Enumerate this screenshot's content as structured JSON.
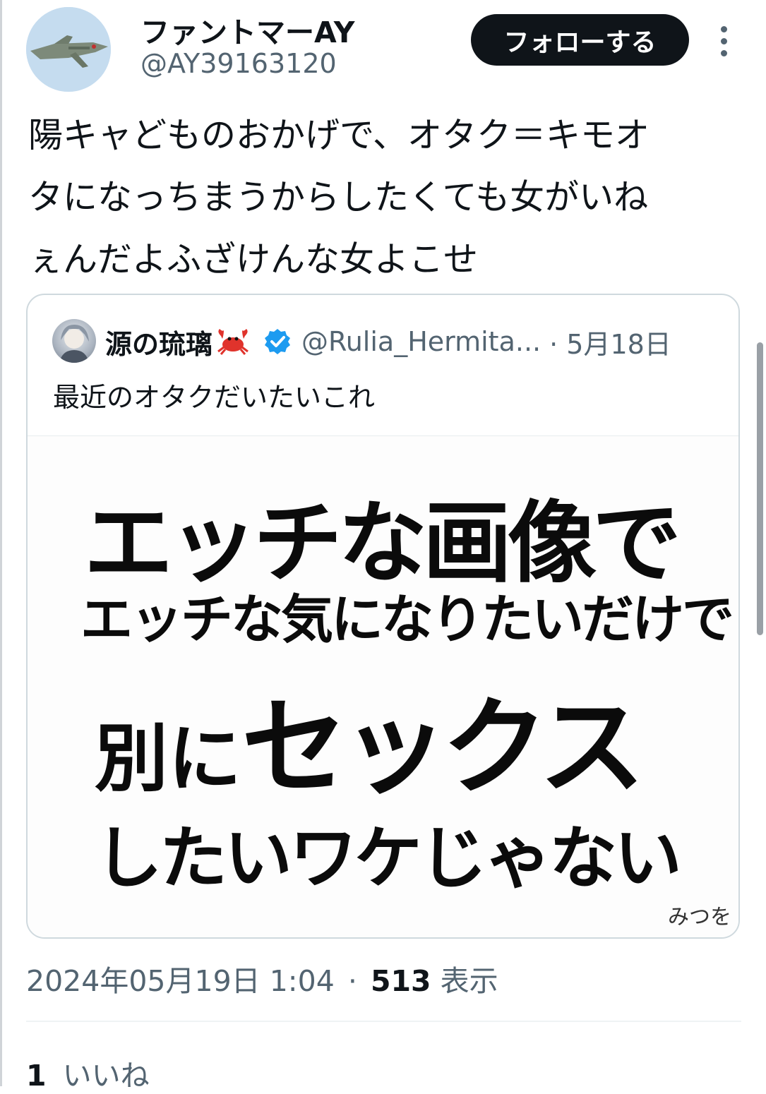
{
  "author": {
    "display_name": "ファントマーAY",
    "handle": "@AY39163120"
  },
  "actions": {
    "follow_label": "フォローする"
  },
  "tweet": {
    "lines": [
      "陽キャどものおかげで、オタク＝キモオ",
      "タになっちまうからしたくても女がいね",
      "ぇんだよふざけんな女よこせ"
    ],
    "timestamp": "2024年05月19日 1:04",
    "separator": "·",
    "views_count": "513",
    "views_label": "表示",
    "likes_count": "1",
    "likes_label": "いいね"
  },
  "quoted": {
    "display_name": "源の琉璃",
    "handle": "@Rulia_Hermita...",
    "date": "· 5月18日",
    "text": "最近のオタクだいたいこれ",
    "image_text": {
      "line1": "エッチな画像で",
      "line2": "エッチな気になりたいだけで",
      "line3a": "別に",
      "line3b": "セックス",
      "line4": "したいワケじゃない",
      "signature": "みつを"
    }
  },
  "icons": {
    "emoji": "crab-icon",
    "badge": "verified-badge-icon",
    "badge_color": "#1d9bf0",
    "more": "more-options-icon"
  }
}
